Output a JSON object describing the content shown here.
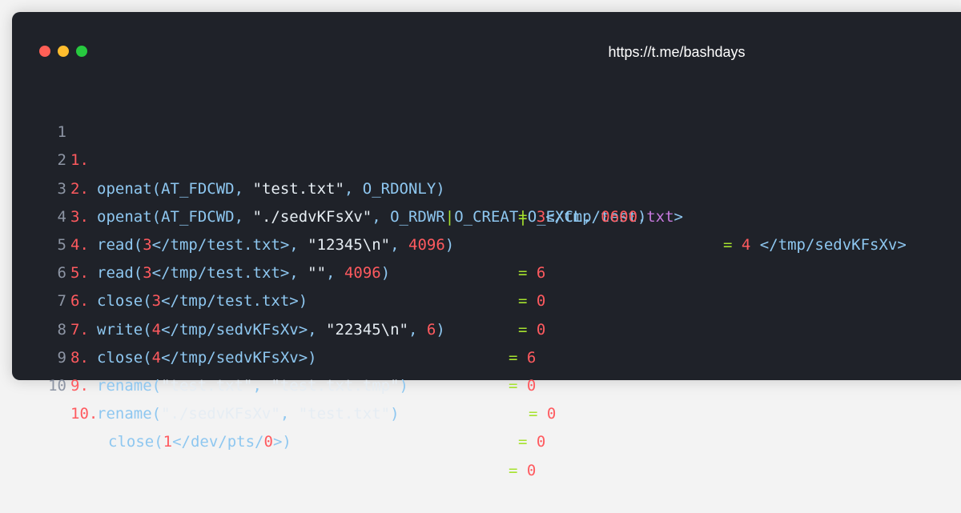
{
  "window": {
    "url": "https://t.me/bashdays",
    "traffic_lights": [
      "close",
      "minimize",
      "maximize"
    ],
    "colors": {
      "background": "#1f2229",
      "red": "#ff5f56",
      "yellow": "#ffbd2e",
      "green": "#27c93f",
      "line_number": "#8d95a4",
      "keyword_blue": "#8ec7f0",
      "number_red": "#ff5a5f",
      "operator_green": "#a6e22e",
      "extension_purple": "#c678dd"
    }
  },
  "lines": [
    {
      "ln": "1",
      "num": "1.",
      "code": [
        [
          "openat",
          "fn"
        ],
        [
          "(",
          "fn"
        ],
        [
          "AT_FDCWD",
          "fn"
        ],
        [
          ", ",
          "fn"
        ],
        [
          "\"test.txt\"",
          "str"
        ],
        [
          ", ",
          "fn"
        ],
        [
          "O_RDONLY",
          "fn"
        ],
        [
          ")",
          "fn"
        ]
      ],
      "eq": "= ",
      "result": [
        [
          "3",
          "red"
        ],
        [
          "</tmp/test.",
          "path"
        ],
        [
          "txt",
          "ext"
        ],
        [
          ">",
          "path"
        ]
      ]
    },
    {
      "ln": "2",
      "num": "2.",
      "code": [
        [
          "openat",
          "fn"
        ],
        [
          "(",
          "fn"
        ],
        [
          "AT_FDCWD",
          "fn"
        ],
        [
          ", ",
          "fn"
        ],
        [
          "\"./sedvKFsXv\"",
          "str"
        ],
        [
          ", ",
          "fn"
        ],
        [
          "O_RDWR",
          "fn"
        ],
        [
          "|",
          "pipe"
        ],
        [
          "O_CREAT",
          "fn"
        ],
        [
          "|",
          "pipe"
        ],
        [
          "O_EXCL",
          "fn"
        ],
        [
          ", ",
          "fn"
        ],
        [
          "0600",
          "red"
        ],
        [
          ")",
          "fn"
        ]
      ],
      "eq": "= ",
      "result": [
        [
          "4",
          "red"
        ],
        [
          " </tmp/sedvKFsXv>",
          "path"
        ]
      ]
    },
    {
      "ln": "3",
      "num": "3.",
      "code": [
        [
          "read",
          "fn"
        ],
        [
          "(",
          "fn"
        ],
        [
          "3",
          "red"
        ],
        [
          "</tmp/test.txt>",
          "path"
        ],
        [
          ", ",
          "fn"
        ],
        [
          "\"12345\\n\"",
          "str"
        ],
        [
          ", ",
          "fn"
        ],
        [
          "4096",
          "red"
        ],
        [
          ")",
          "fn"
        ]
      ],
      "eq": "= ",
      "result": [
        [
          "6",
          "red"
        ]
      ]
    },
    {
      "ln": "4",
      "num": "4.",
      "code": [
        [
          "read",
          "fn"
        ],
        [
          "(",
          "fn"
        ],
        [
          "3",
          "red"
        ],
        [
          "</tmp/test.txt>",
          "path"
        ],
        [
          ", ",
          "fn"
        ],
        [
          "\"\"",
          "str"
        ],
        [
          ", ",
          "fn"
        ],
        [
          "4096",
          "red"
        ],
        [
          ")",
          "fn"
        ]
      ],
      "eq": "= ",
      "result": [
        [
          "0",
          "red"
        ]
      ]
    },
    {
      "ln": "5",
      "num": "5.",
      "code": [
        [
          "close",
          "fn"
        ],
        [
          "(",
          "fn"
        ],
        [
          "3",
          "red"
        ],
        [
          "</tmp/test.txt>",
          "path"
        ],
        [
          ")",
          "fn"
        ]
      ],
      "eq": "= ",
      "result": [
        [
          "0",
          "red"
        ]
      ]
    },
    {
      "ln": "6",
      "num": "6.",
      "code": [
        [
          "write",
          "fn"
        ],
        [
          "(",
          "fn"
        ],
        [
          "4",
          "red"
        ],
        [
          "</tmp/sedvKFsXv>",
          "path"
        ],
        [
          ", ",
          "fn"
        ],
        [
          "\"22345\\n\"",
          "str"
        ],
        [
          ", ",
          "fn"
        ],
        [
          "6",
          "red"
        ],
        [
          ")",
          "fn"
        ]
      ],
      "eq": "= ",
      "result": [
        [
          "6",
          "red"
        ]
      ]
    },
    {
      "ln": "7",
      "num": "7.",
      "code": [
        [
          "close",
          "fn"
        ],
        [
          "(",
          "fn"
        ],
        [
          "4",
          "red"
        ],
        [
          "</tmp/sedvKFsXv>",
          "path"
        ],
        [
          ")",
          "fn"
        ]
      ],
      "eq": "= ",
      "result": [
        [
          "0",
          "red"
        ]
      ]
    },
    {
      "ln": "8",
      "num": "8.",
      "code": [
        [
          "rename",
          "fn"
        ],
        [
          "(",
          "fn"
        ],
        [
          "\"test.txt\"",
          "str"
        ],
        [
          ", ",
          "fn"
        ],
        [
          "\"test.txt.tmp\"",
          "str"
        ],
        [
          ")",
          "fn"
        ]
      ],
      "eq": "= ",
      "result": [
        [
          "0",
          "red"
        ]
      ]
    },
    {
      "ln": "9",
      "num": "9.",
      "code": [
        [
          "rename",
          "fn"
        ],
        [
          "(",
          "fn"
        ],
        [
          "\"./sedvKFsXv\"",
          "str"
        ],
        [
          ", ",
          "fn"
        ],
        [
          "\"test.txt\"",
          "str"
        ],
        [
          ")",
          "fn"
        ]
      ],
      "eq": "= ",
      "result": [
        [
          "0",
          "red"
        ]
      ]
    },
    {
      "ln": "10",
      "num": "10.",
      "code": [
        [
          "close",
          "fn"
        ],
        [
          "(",
          "fn"
        ],
        [
          "1",
          "red"
        ],
        [
          "</dev/pts/",
          "path"
        ],
        [
          "0",
          "red"
        ],
        [
          ">)",
          "path"
        ]
      ],
      "eq": "= ",
      "result": [
        [
          "0",
          "red"
        ]
      ]
    }
  ]
}
